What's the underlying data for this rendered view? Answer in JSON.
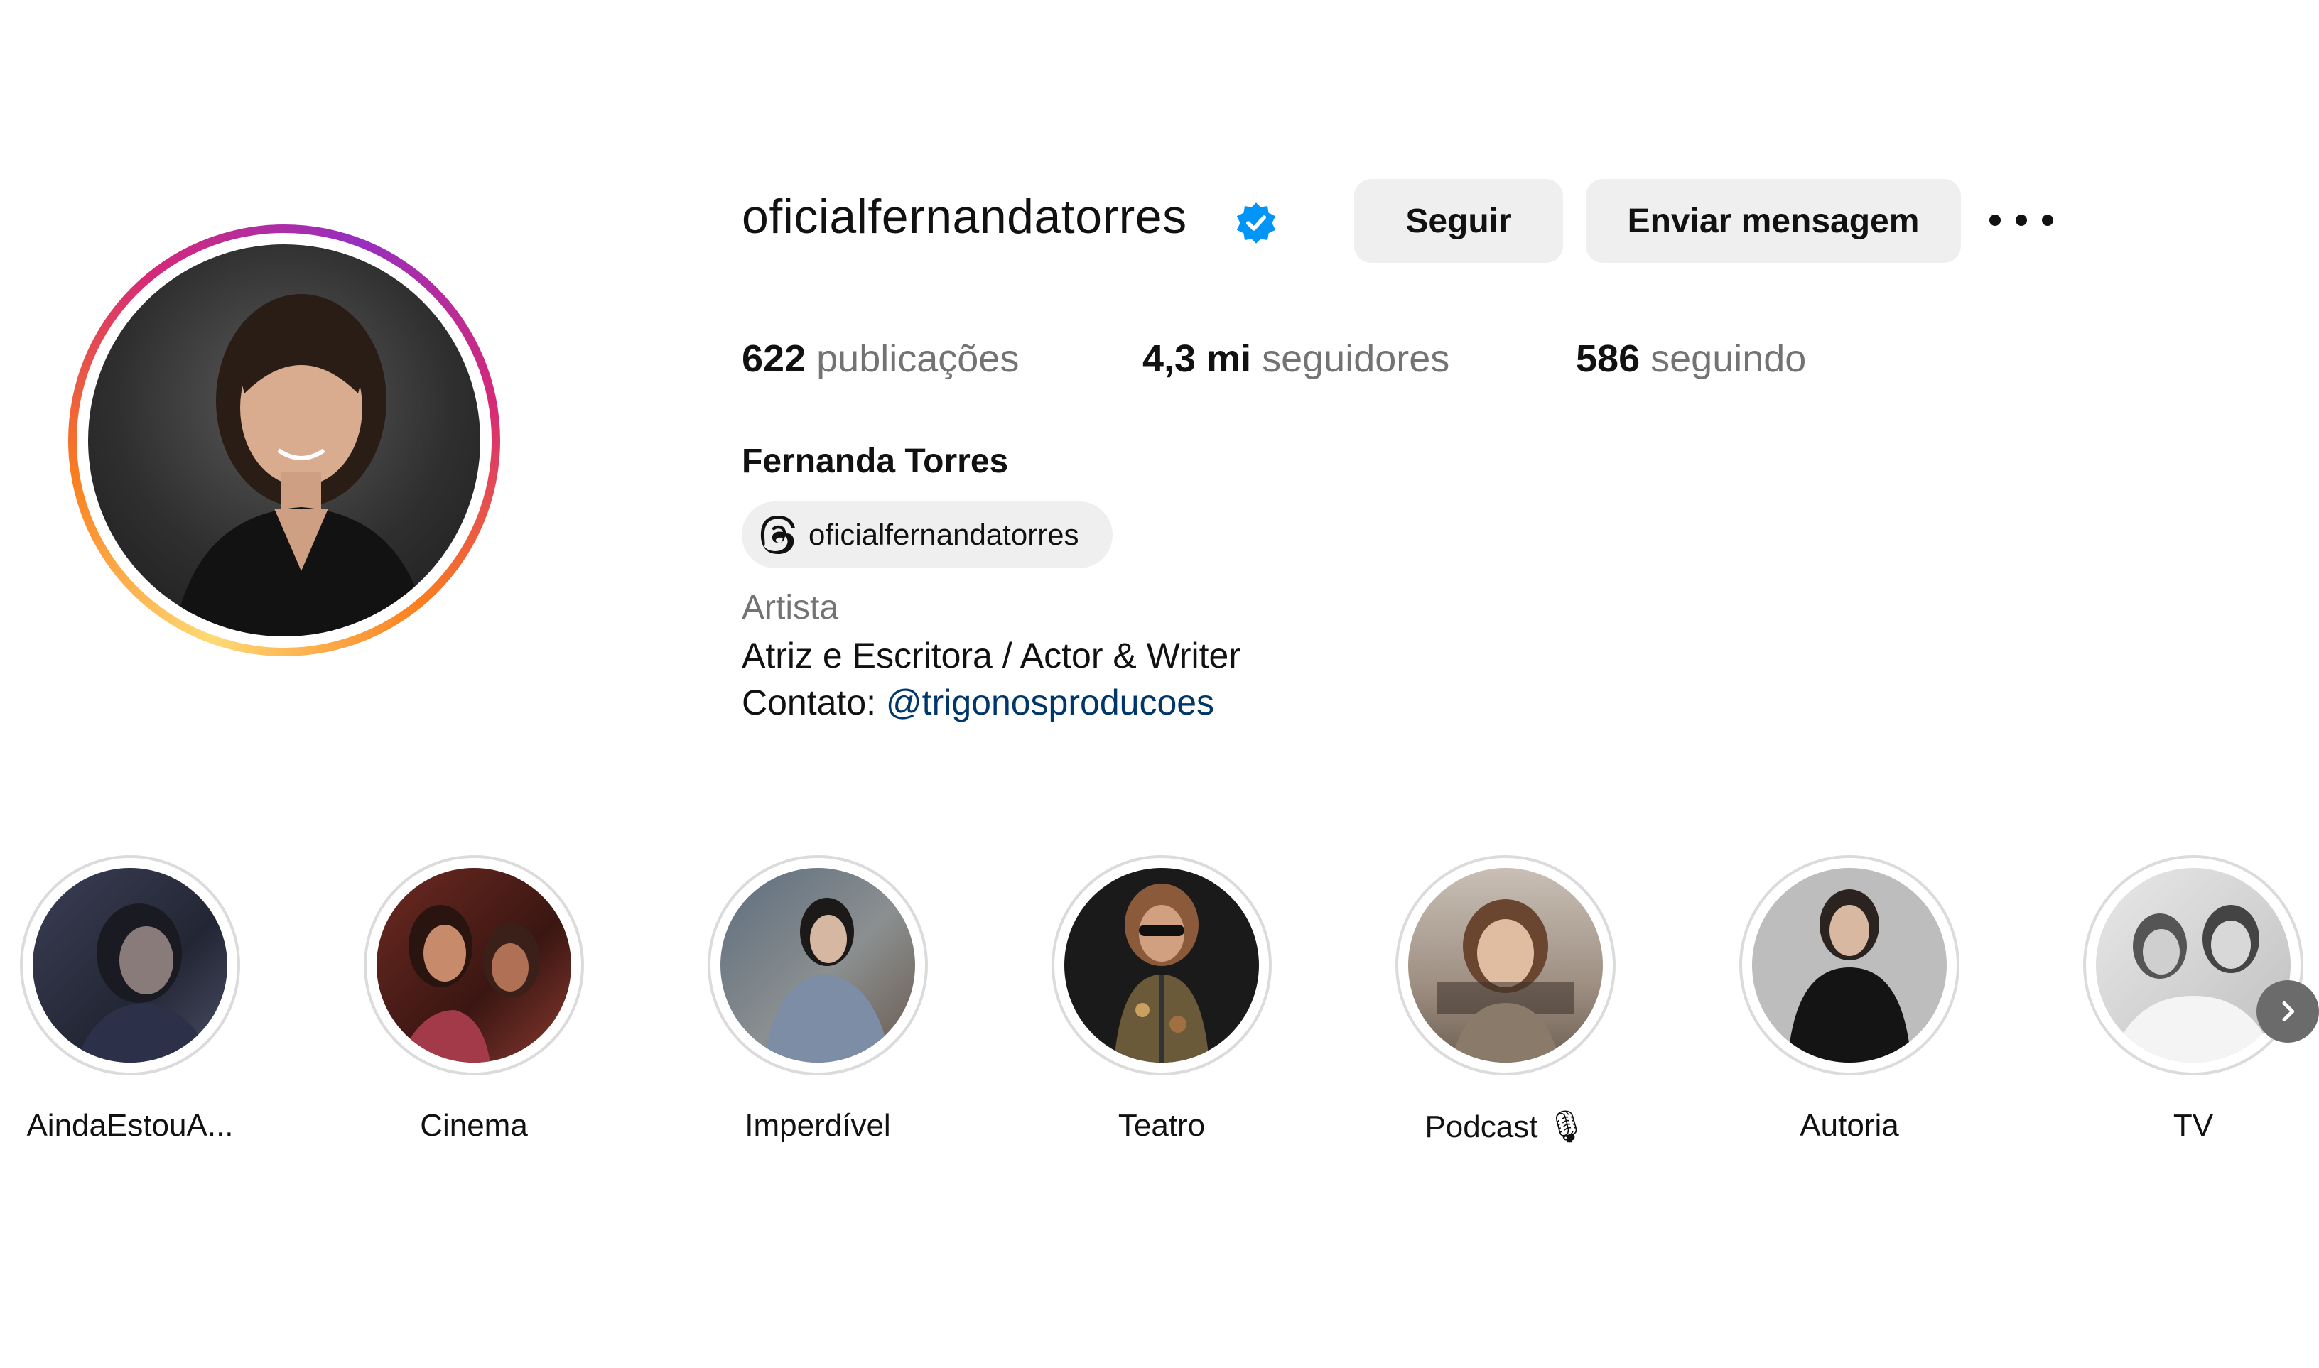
{
  "profile": {
    "username": "oficialfernandatorres",
    "verified": true,
    "follow_label": "Seguir",
    "message_label": "Enviar mensagem",
    "stats": {
      "posts_count": "622",
      "posts_label": "publicações",
      "followers_count": "4,3 mi",
      "followers_label": "seguidores",
      "following_count": "586",
      "following_label": "seguindo"
    },
    "full_name": "Fernanda Torres",
    "threads_handle": "oficialfernandatorres",
    "category": "Artista",
    "bio_line1": "Atriz e Escritora / Actor & Writer",
    "bio_contact_prefix": "Contato:",
    "bio_contact_link": "@trigonosproducoes"
  },
  "highlights": [
    {
      "label": "AindaEstouA..."
    },
    {
      "label": "Cinema"
    },
    {
      "label": "Imperdível"
    },
    {
      "label": "Teatro"
    },
    {
      "label": "Podcast 🎙"
    },
    {
      "label": "Autoria"
    },
    {
      "label": "TV"
    }
  ],
  "icons": {
    "verified": "verified-badge-icon",
    "more": "more-options-icon",
    "threads": "threads-icon",
    "next": "chevron-right-icon"
  },
  "colors": {
    "verified_blue": "#0095f6",
    "link": "#00376b",
    "button_bg": "#efefef",
    "secondary_text": "#737373"
  }
}
